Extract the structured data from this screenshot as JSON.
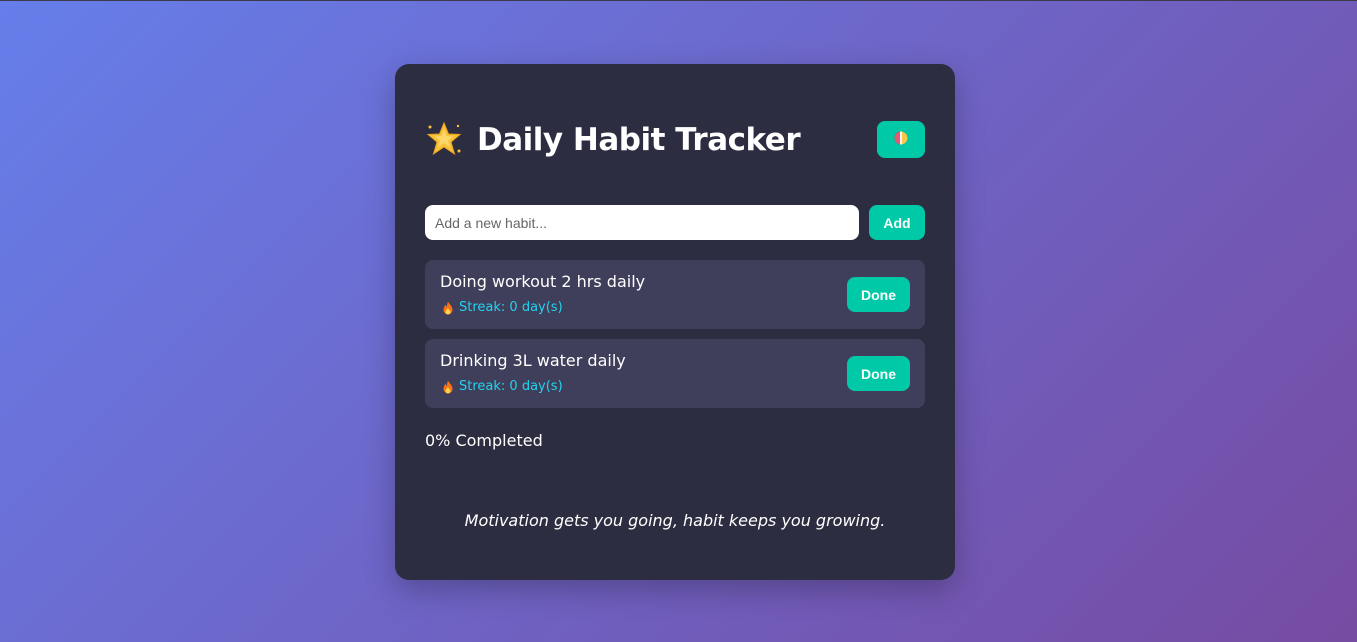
{
  "app": {
    "title": "Daily Habit Tracker",
    "icon": "star-icon",
    "theme_toggle_icon": "theme-toggle-icon"
  },
  "add_form": {
    "placeholder": "Add a new habit...",
    "value": "",
    "add_label": "Add"
  },
  "habits": [
    {
      "name": "Doing workout 2 hrs daily",
      "streak": "Streak: 0 day(s)",
      "streak_icon": "fire-icon",
      "done_label": "Done"
    },
    {
      "name": "Drinking 3L water daily",
      "streak": "Streak: 0 day(s)",
      "streak_icon": "fire-icon",
      "done_label": "Done"
    }
  ],
  "progress": {
    "text": "0% Completed",
    "value": 0
  },
  "quote": "Motivation gets you going, habit keeps you growing.",
  "colors": {
    "accent": "#00c9a7",
    "card": "#2d2d42",
    "habit_bg": "#3f3f5b",
    "streak": "#22d3ee",
    "gradient_start": "#667eea",
    "gradient_end": "#764ba2"
  }
}
